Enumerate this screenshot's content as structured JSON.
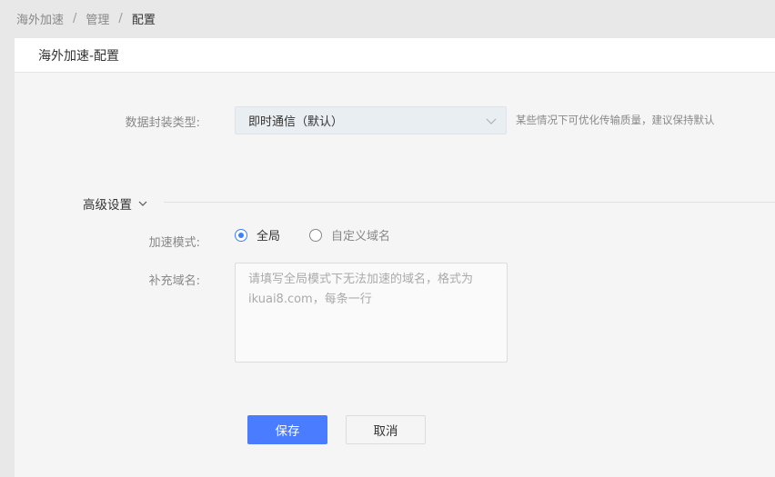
{
  "breadcrumb": {
    "items": [
      "海外加速",
      "管理",
      "配置"
    ],
    "separator": "/"
  },
  "panel": {
    "title": "海外加速-配置"
  },
  "form": {
    "encapsulation": {
      "label": "数据封装类型:",
      "value": "即时通信（默认）",
      "hint": "某些情况下可优化传输质量，建议保持默认"
    },
    "advanced": {
      "title": "高级设置"
    },
    "mode": {
      "label": "加速模式:",
      "options": [
        "全局",
        "自定义域名"
      ],
      "selected": "全局"
    },
    "domains": {
      "label": "补充域名:",
      "value": "",
      "placeholder": "请填写全局模式下无法加速的域名，格式为ikuai8.com，每条一行"
    },
    "buttons": {
      "save": "保存",
      "cancel": "取消"
    }
  },
  "colors": {
    "primary": "#4a7cff",
    "radio_checked": "#3d7fff"
  }
}
